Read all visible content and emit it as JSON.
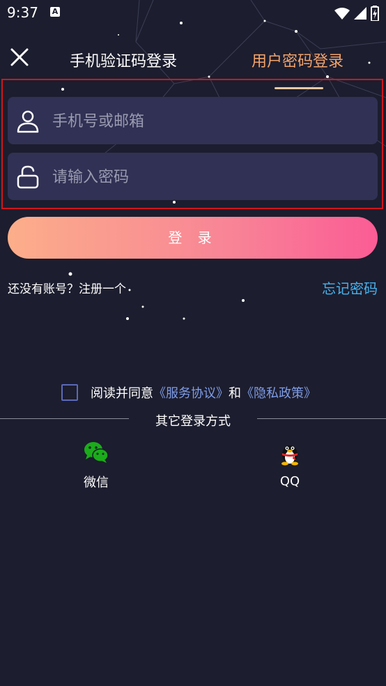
{
  "status_bar": {
    "time": "9:37",
    "notification_icon": "A"
  },
  "header": {
    "close_icon": "close-icon",
    "tab_sms": "手机验证码登录",
    "tab_password": "用户密码登录"
  },
  "form": {
    "account_placeholder": "手机号或邮箱",
    "password_placeholder": "请输入密码",
    "account_icon": "user-icon",
    "password_icon": "lock-icon"
  },
  "login_button": "登 录",
  "register_text": "还没有账号？注册一个",
  "forgot_text": "忘记密码",
  "agreement": {
    "prefix": "阅读并同意",
    "service": "《服务协议》",
    "and": "和",
    "privacy": "《隐私政策》"
  },
  "other_login": {
    "title": "其它登录方式",
    "options": [
      {
        "label": "微信",
        "icon": "wechat-icon"
      },
      {
        "label": "QQ",
        "icon": "qq-icon"
      }
    ]
  },
  "colors": {
    "background": "#1c1d2e",
    "active_tab": "#f2a36b",
    "link": "#47b3ee",
    "field_bg": "#303154"
  }
}
